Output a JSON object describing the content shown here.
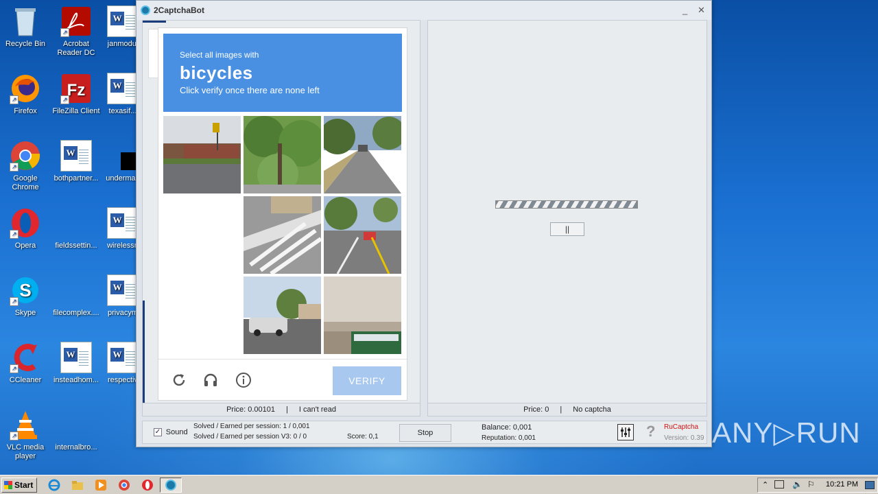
{
  "desktop": {
    "icons": [
      {
        "label": "Recycle Bin"
      },
      {
        "label": "Acrobat Reader DC"
      },
      {
        "label": "janmodul"
      },
      {
        "label": "Firefox"
      },
      {
        "label": "FileZilla Client"
      },
      {
        "label": "texasif..."
      },
      {
        "label": "Google Chrome"
      },
      {
        "label": "bothpartner..."
      },
      {
        "label": "underman"
      },
      {
        "label": "Opera"
      },
      {
        "label": "fieldssettin..."
      },
      {
        "label": "wirelessn"
      },
      {
        "label": "Skype"
      },
      {
        "label": "filecomplex...."
      },
      {
        "label": "privacym"
      },
      {
        "label": "CCleaner"
      },
      {
        "label": "insteadhom..."
      },
      {
        "label": "respectiv"
      },
      {
        "label": "VLC media player"
      },
      {
        "label": "internalbro..."
      }
    ]
  },
  "window": {
    "title": "2CaptchaBot",
    "minimize": "_",
    "close": "✕"
  },
  "captcha": {
    "instruction": "Select all images with",
    "target": "bicycles",
    "subtext": "Click verify once there are none left",
    "verify_label": "VERIFY",
    "icons": [
      "reload-icon",
      "audio-icon",
      "info-icon"
    ],
    "accent": "#4a90e2"
  },
  "left_status": {
    "price": "Price: 0.00101",
    "separator": "|",
    "cant_read": "I can't read"
  },
  "right_pane": {
    "pause_label": "||"
  },
  "right_status": {
    "price": "Price: 0",
    "separator": "|",
    "state": "No captcha"
  },
  "bottom": {
    "sound_label": "Sound",
    "sound_checked": true,
    "check_mark": "✓",
    "solved_session": "Solved / Earned per session: 1 / 0,001",
    "solved_session_v3": "Solved / Earned per session V3: 0 / 0",
    "score": "Score: 0,1",
    "stop_label": "Stop",
    "balance": "Balance:  0,001",
    "reputation": "Reputation: 0,001",
    "brand": "RuCaptcha",
    "version": "Version: 0.39",
    "help": "?"
  },
  "taskbar": {
    "start_label": "Start",
    "clock": "10:21 PM"
  },
  "watermark": "ANY▷RUN"
}
